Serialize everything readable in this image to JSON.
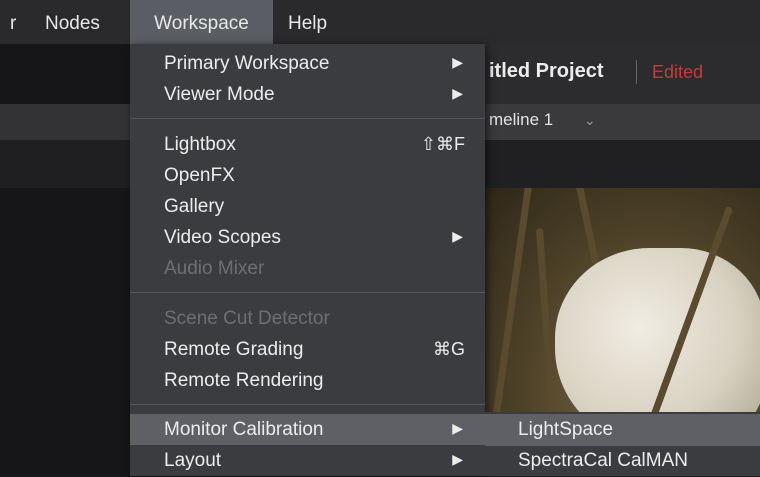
{
  "menubar": {
    "partial_prev": "r",
    "items": [
      {
        "label": "Nodes"
      },
      {
        "label": "Workspace"
      },
      {
        "label": "Help"
      }
    ]
  },
  "header": {
    "project_title": "itled Project",
    "edited": "Edited",
    "timeline": "meline 1",
    "chevron": "⌄"
  },
  "workspace_menu": {
    "items": {
      "primary_workspace": "Primary Workspace",
      "viewer_mode": "Viewer Mode",
      "lightbox": "Lightbox",
      "lightbox_shortcut": "⇧⌘F",
      "openfx": "OpenFX",
      "gallery": "Gallery",
      "video_scopes": "Video Scopes",
      "audio_mixer": "Audio Mixer",
      "scene_cut_detector": "Scene Cut Detector",
      "remote_grading": "Remote Grading",
      "remote_grading_shortcut": "⌘G",
      "remote_rendering": "Remote Rendering",
      "monitor_calibration": "Monitor Calibration",
      "layout": "Layout"
    },
    "arrow": "▶"
  },
  "calibration_submenu": {
    "items": [
      "LightSpace",
      "SpectraCal CalMAN"
    ]
  }
}
